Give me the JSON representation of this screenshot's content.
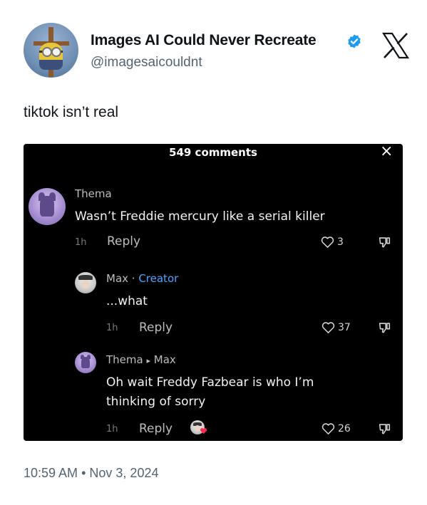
{
  "tweet": {
    "display_name": "Images AI Could Never Recreate",
    "handle": "@imagesaicouldnt",
    "text": "tiktok isn’t real",
    "timestamp": "10:59 AM",
    "separator": "•",
    "date": "Nov 3, 2024",
    "colors": {
      "verified": "#1d9bf0",
      "secondary_text": "#536471"
    }
  },
  "embedded": {
    "comments_count": "549 comments",
    "close_icon": "×",
    "comments": [
      {
        "user": "Thema",
        "text": "Wasn’t Freddie mercury like a serial killer",
        "time": "1h",
        "reply_label": "Reply",
        "likes": "3"
      },
      {
        "user": "Max",
        "separator": " · ",
        "tag": "Creator",
        "text": "...what",
        "time": "1h",
        "reply_label": "Reply",
        "likes": "37"
      },
      {
        "user": "Thema",
        "arrow": "▸",
        "reply_to": "Max",
        "text_line1": "Oh wait Freddy Fazbear is who I’m",
        "text_line2": "thinking of sorry",
        "time": "1h",
        "reply_label": "Reply",
        "likes": "26"
      }
    ]
  }
}
